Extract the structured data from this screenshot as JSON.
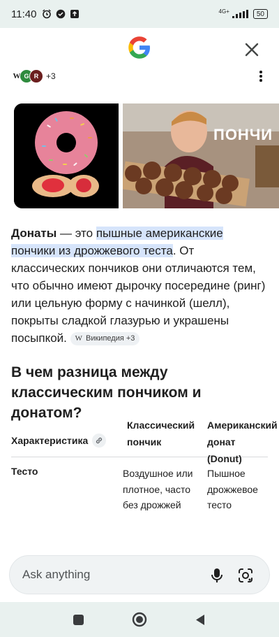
{
  "status_bar": {
    "time": "11:40",
    "network": "4G+",
    "battery": "50"
  },
  "header": {
    "logo": "google-g-logo",
    "close_icon": "close-icon"
  },
  "sources": {
    "icons": [
      "W",
      "G",
      "R"
    ],
    "count": "+3"
  },
  "images": [
    {
      "alt_icon": "donut-photo"
    },
    {
      "overlay_text": "ПОНЧИ"
    }
  ],
  "answer": {
    "term": "Донаты",
    "dash": " — это ",
    "highlight": "пышные американские пончики из дрожжевого теста",
    "rest": ". От классических пончиков они отличаются тем, что обычно имеют дырочку посередине (ринг) или цельную форму с начинкой (шелл), покрыты сладкой глазурью и украшены посыпкой.",
    "chip_icon": "W",
    "chip_label": "Википедия +3"
  },
  "section": {
    "title": "В чем разница между классическим пончиком и донатом?"
  },
  "table": {
    "headers": [
      "Характеристика",
      "Классический пончик",
      "Американский донат (Donut)"
    ],
    "rows": [
      [
        "Тесто",
        "Воздушное или плотное, часто без дрожжей",
        "Пышное дрожжевое тесто"
      ]
    ]
  },
  "ask_bar": {
    "placeholder": "Ask anything"
  },
  "colors": {
    "highlight": "#d6e4fb",
    "system_bar": "#e9f1ef",
    "ask_bar": "#f0f3f4"
  }
}
